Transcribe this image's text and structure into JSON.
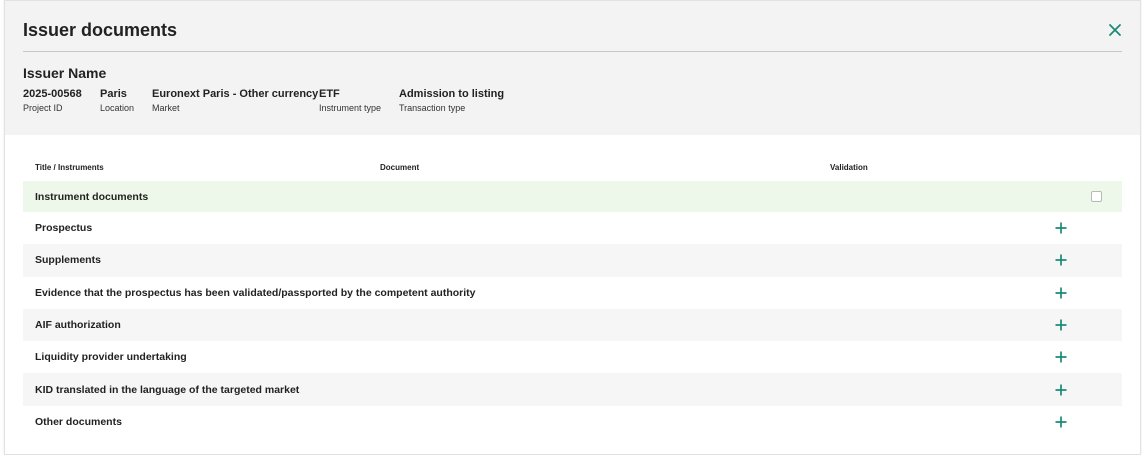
{
  "dialog": {
    "title": "Issuer documents",
    "close_icon": "close-icon",
    "accent_color": "#1a8a78"
  },
  "issuer": {
    "name": "Issuer Name",
    "fields": [
      {
        "value": "2025-00568",
        "label": "Project ID"
      },
      {
        "value": "Paris",
        "label": "Location"
      },
      {
        "value": "Euronext Paris - Other currency",
        "label": "Market"
      },
      {
        "value": "ETF",
        "label": "Instrument type"
      },
      {
        "value": "Admission to listing",
        "label": "Transaction type"
      }
    ]
  },
  "table": {
    "columns": [
      "Title / Instruments",
      "Document",
      "Validation"
    ],
    "group_row": {
      "label": "Instrument documents",
      "checked": false
    },
    "rows": [
      {
        "label": "Prospectus",
        "action_icon": "plus-icon"
      },
      {
        "label": "Supplements",
        "action_icon": "plus-icon"
      },
      {
        "label": "Evidence that the prospectus has been validated/passported by the competent authority",
        "action_icon": "plus-icon"
      },
      {
        "label": "AIF authorization",
        "action_icon": "plus-icon"
      },
      {
        "label": "Liquidity provider undertaking",
        "action_icon": "plus-icon"
      },
      {
        "label": "KID translated in the language of the targeted market",
        "action_icon": "plus-icon"
      },
      {
        "label": "Other documents",
        "action_icon": "plus-icon"
      }
    ]
  }
}
